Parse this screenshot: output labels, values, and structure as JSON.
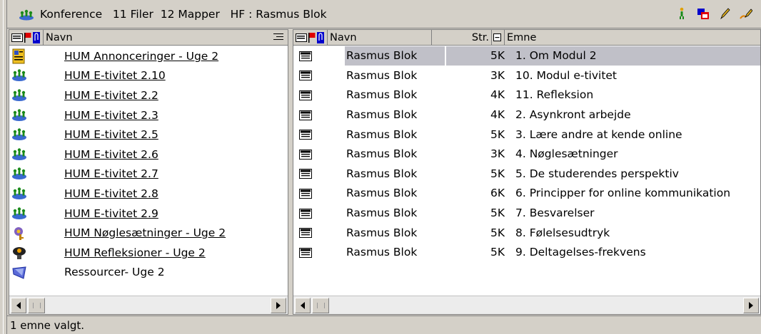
{
  "window": {
    "title": "Konference   11 Filer  12 Mapper   HF : Rasmus Blok"
  },
  "toolbar": {
    "icons": [
      "person-icon",
      "windows-icon",
      "pencil-icon",
      "edit-icon"
    ]
  },
  "left_pane": {
    "column_header": "Navn",
    "items": [
      {
        "label": "HUM Annonceringer - Uge 2",
        "icon": "bulletin-icon",
        "link": true
      },
      {
        "label": "HUM E-tivitet 2.10",
        "icon": "conference-icon",
        "link": true
      },
      {
        "label": "HUM E-tivitet 2.2",
        "icon": "conference-icon",
        "link": true
      },
      {
        "label": "HUM E-tivitet 2.3",
        "icon": "conference-icon",
        "link": true
      },
      {
        "label": "HUM E-tivitet 2.5",
        "icon": "conference-icon",
        "link": true
      },
      {
        "label": "HUM E-tivitet 2.6",
        "icon": "conference-icon",
        "link": true
      },
      {
        "label": "HUM E-tivitet 2.7",
        "icon": "conference-icon",
        "link": true
      },
      {
        "label": "HUM E-tivitet 2.8",
        "icon": "conference-icon",
        "link": true
      },
      {
        "label": "HUM E-tivitet 2.9",
        "icon": "conference-icon",
        "link": true
      },
      {
        "label": "HUM Nøglesætninger - Uge 2",
        "icon": "key-icon",
        "link": true
      },
      {
        "label": "HUM Refleksioner - Uge 2",
        "icon": "lamp-icon",
        "link": true
      },
      {
        "label": "Ressourcer- Uge 2",
        "icon": "resource-folder-icon",
        "link": false
      }
    ]
  },
  "right_pane": {
    "headers": {
      "name": "Navn",
      "size": "Str.",
      "subject": "Emne"
    },
    "rows": [
      {
        "name": "Rasmus Blok",
        "size": "5K",
        "subject": "1. Om Modul 2",
        "selected": true
      },
      {
        "name": "Rasmus Blok",
        "size": "3K",
        "subject": "10. Modul e-tivitet",
        "selected": false
      },
      {
        "name": "Rasmus Blok",
        "size": "4K",
        "subject": "11. Refleksion",
        "selected": false
      },
      {
        "name": "Rasmus Blok",
        "size": "4K",
        "subject": "2. Asynkront arbejde",
        "selected": false
      },
      {
        "name": "Rasmus Blok",
        "size": "5K",
        "subject": "3. Lære andre at kende online",
        "selected": false
      },
      {
        "name": "Rasmus Blok",
        "size": "3K",
        "subject": "4. Nøglesætninger",
        "selected": false
      },
      {
        "name": "Rasmus Blok",
        "size": "5K",
        "subject": "5. De studerendes perspektiv",
        "selected": false
      },
      {
        "name": "Rasmus Blok",
        "size": "6K",
        "subject": "6. Principper for online kommunikation",
        "selected": false
      },
      {
        "name": "Rasmus Blok",
        "size": "5K",
        "subject": "7. Besvarelser",
        "selected": false
      },
      {
        "name": "Rasmus Blok",
        "size": "5K",
        "subject": "8. Følelsesudtryk",
        "selected": false
      },
      {
        "name": "Rasmus Blok",
        "size": "5K",
        "subject": "9. Deltagelses-frekvens",
        "selected": false
      }
    ]
  },
  "status": {
    "text": "1 emne valgt."
  },
  "colors": {
    "chrome": "#d4d0c8",
    "selection": "#c0c0c8",
    "flag_red": "#e00000",
    "clip_blue": "#0000cc"
  }
}
